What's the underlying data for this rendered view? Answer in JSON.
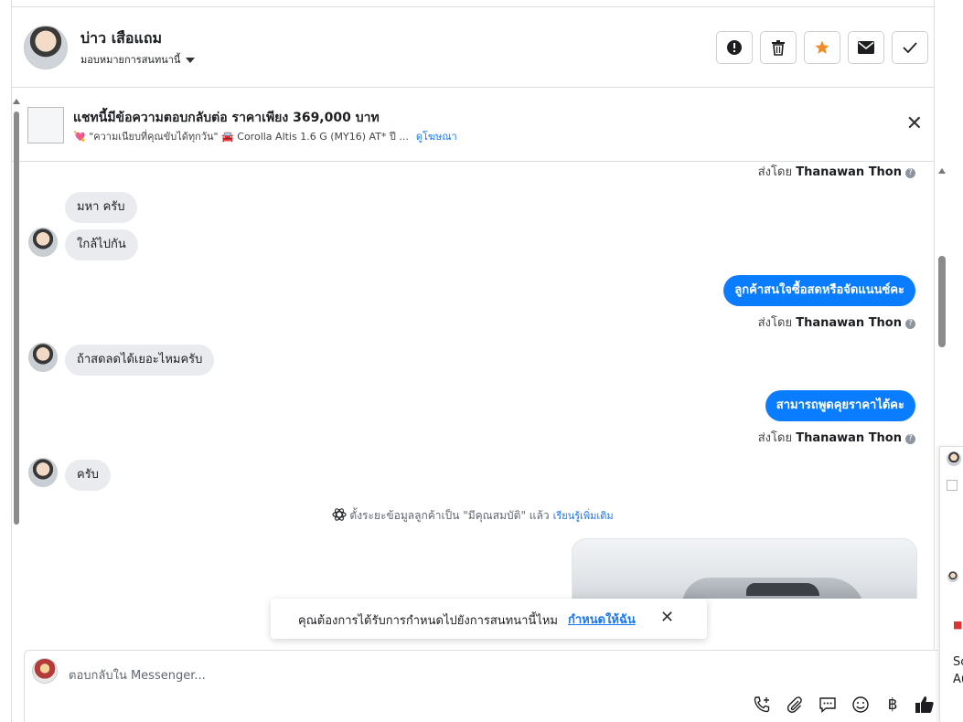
{
  "header": {
    "name": "บ่าว เสือแถม",
    "assign_label": "มอบหมายการสนทนานี้"
  },
  "ad_banner": {
    "title": "แชทนี้มีข้อความตอบกลับต่อ ราคาเพียง 369,000 บาท",
    "subtitle": "💘 \"ความเนียบที่คุณขับได้ทุกวัน\" 🚘 Corolla Altis 1.6 G (MY16) AT* ปี ...",
    "link": "ดูโฆษณา"
  },
  "messages": {
    "sent_prefix": "ส่งโดย",
    "agent_name": "Thanawan Thon",
    "in_1": "มหา ครับ",
    "in_2": "ใกล้ไปกัน",
    "out_1": "ลูกค้าสนใจซื้อสดหรือจัดแนนซ์คะ",
    "in_3": "ถ้าสดลดได้เยอะไหมครับ",
    "out_2": "สามารถพูดคุยราคาได้คะ",
    "in_4": "ครับ"
  },
  "system_note": {
    "text": "ตั้งระยะข้อมูลลูกค้าเป็น \"มีคุณสมบัติ\" แล้ว",
    "link": "เรียนรู้เพิ่มเติม"
  },
  "toast": {
    "text": "คุณต้องการได้รับการกำหนดไปยังการสนทนานี้ไหม",
    "link": "กำหนดให้ฉัน"
  },
  "composer": {
    "placeholder": "ตอบกลับใน Messenger..."
  },
  "right_panel": {
    "text_1": "Sc",
    "text_2": "Au"
  },
  "colors": {
    "accent": "#0a7cff",
    "link": "#1877f2",
    "star": "#f28c28",
    "incoming_bubble": "#e9ebee"
  }
}
